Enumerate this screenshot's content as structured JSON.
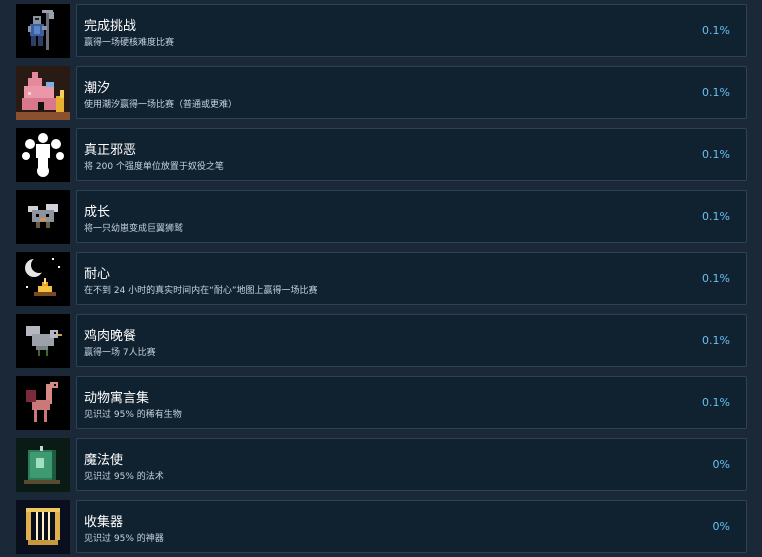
{
  "achievements": [
    {
      "icon": "armored-knight-with-halberd-icon",
      "title": "完成挑战",
      "description": "赢得一场硬核难度比赛",
      "percent": "0.1%"
    },
    {
      "icon": "pink-conch-shell-house-icon",
      "title": "潮汐",
      "description": "使用潮汐赢得一场比赛（普通或更难）",
      "percent": "0.1%"
    },
    {
      "icon": "white-splat-drop-icon",
      "title": "真正邪恶",
      "description": "将 200 个强度单位放置于奴役之笔",
      "percent": "0.1%"
    },
    {
      "icon": "small-creature-icon",
      "title": "成长",
      "description": "将一只幼崽变成巨翼狮鹫",
      "percent": "0.1%"
    },
    {
      "icon": "crescent-moon-campfire-icon",
      "title": "耐心",
      "description": "在不到 24 小时的真实时间内在“耐心”地图上赢得一场比赛",
      "percent": "0.1%"
    },
    {
      "icon": "grey-dove-icon",
      "title": "鸡肉晚餐",
      "description": "赢得一场 7人比赛",
      "percent": "0.1%"
    },
    {
      "icon": "pink-winged-beast-icon",
      "title": "动物寓言集",
      "description": "见识过 95% 的稀有生物",
      "percent": "0.1%"
    },
    {
      "icon": "spellbook-icon",
      "title": "魔法使",
      "description": "见识过 95% 的法术",
      "percent": "0%"
    },
    {
      "icon": "golden-lyre-icon",
      "title": "收集器",
      "description": "见识过 95% 的神器",
      "percent": "0%"
    }
  ]
}
